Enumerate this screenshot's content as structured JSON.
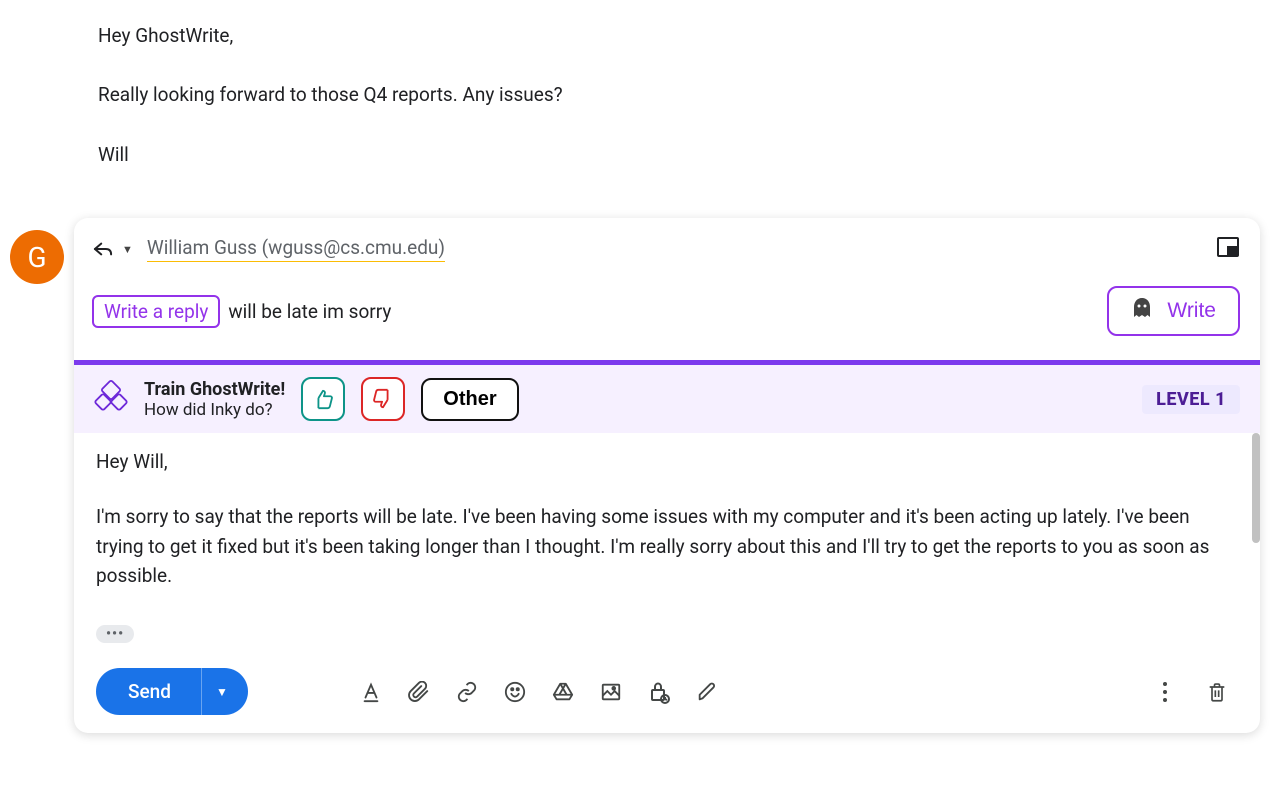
{
  "original": {
    "line1": "Hey GhostWrite,",
    "line2": "Really looking forward to those Q4 reports. Any issues?",
    "line3": "Will"
  },
  "avatar_initial": "G",
  "recipient": "William Guss (wguss@cs.cmu.edu)",
  "prompt": {
    "chip": "Write a reply",
    "text": "will be late im sorry"
  },
  "write_button": "Write",
  "feedback": {
    "title": "Train GhostWrite!",
    "subtitle": "How did Inky do?",
    "other": "Other",
    "level": "LEVEL 1"
  },
  "compose": {
    "greeting": "Hey Will,",
    "body": "I'm sorry to say that the reports will be late. I've been having some issues with my computer and it's been acting up lately. I've been trying to get it fixed but it's been taking longer than I thought. I'm really sorry about this and I'll try to get the reports to you as soon as possible.",
    "trimmed": "•••"
  },
  "toolbar": {
    "send": "Send"
  }
}
